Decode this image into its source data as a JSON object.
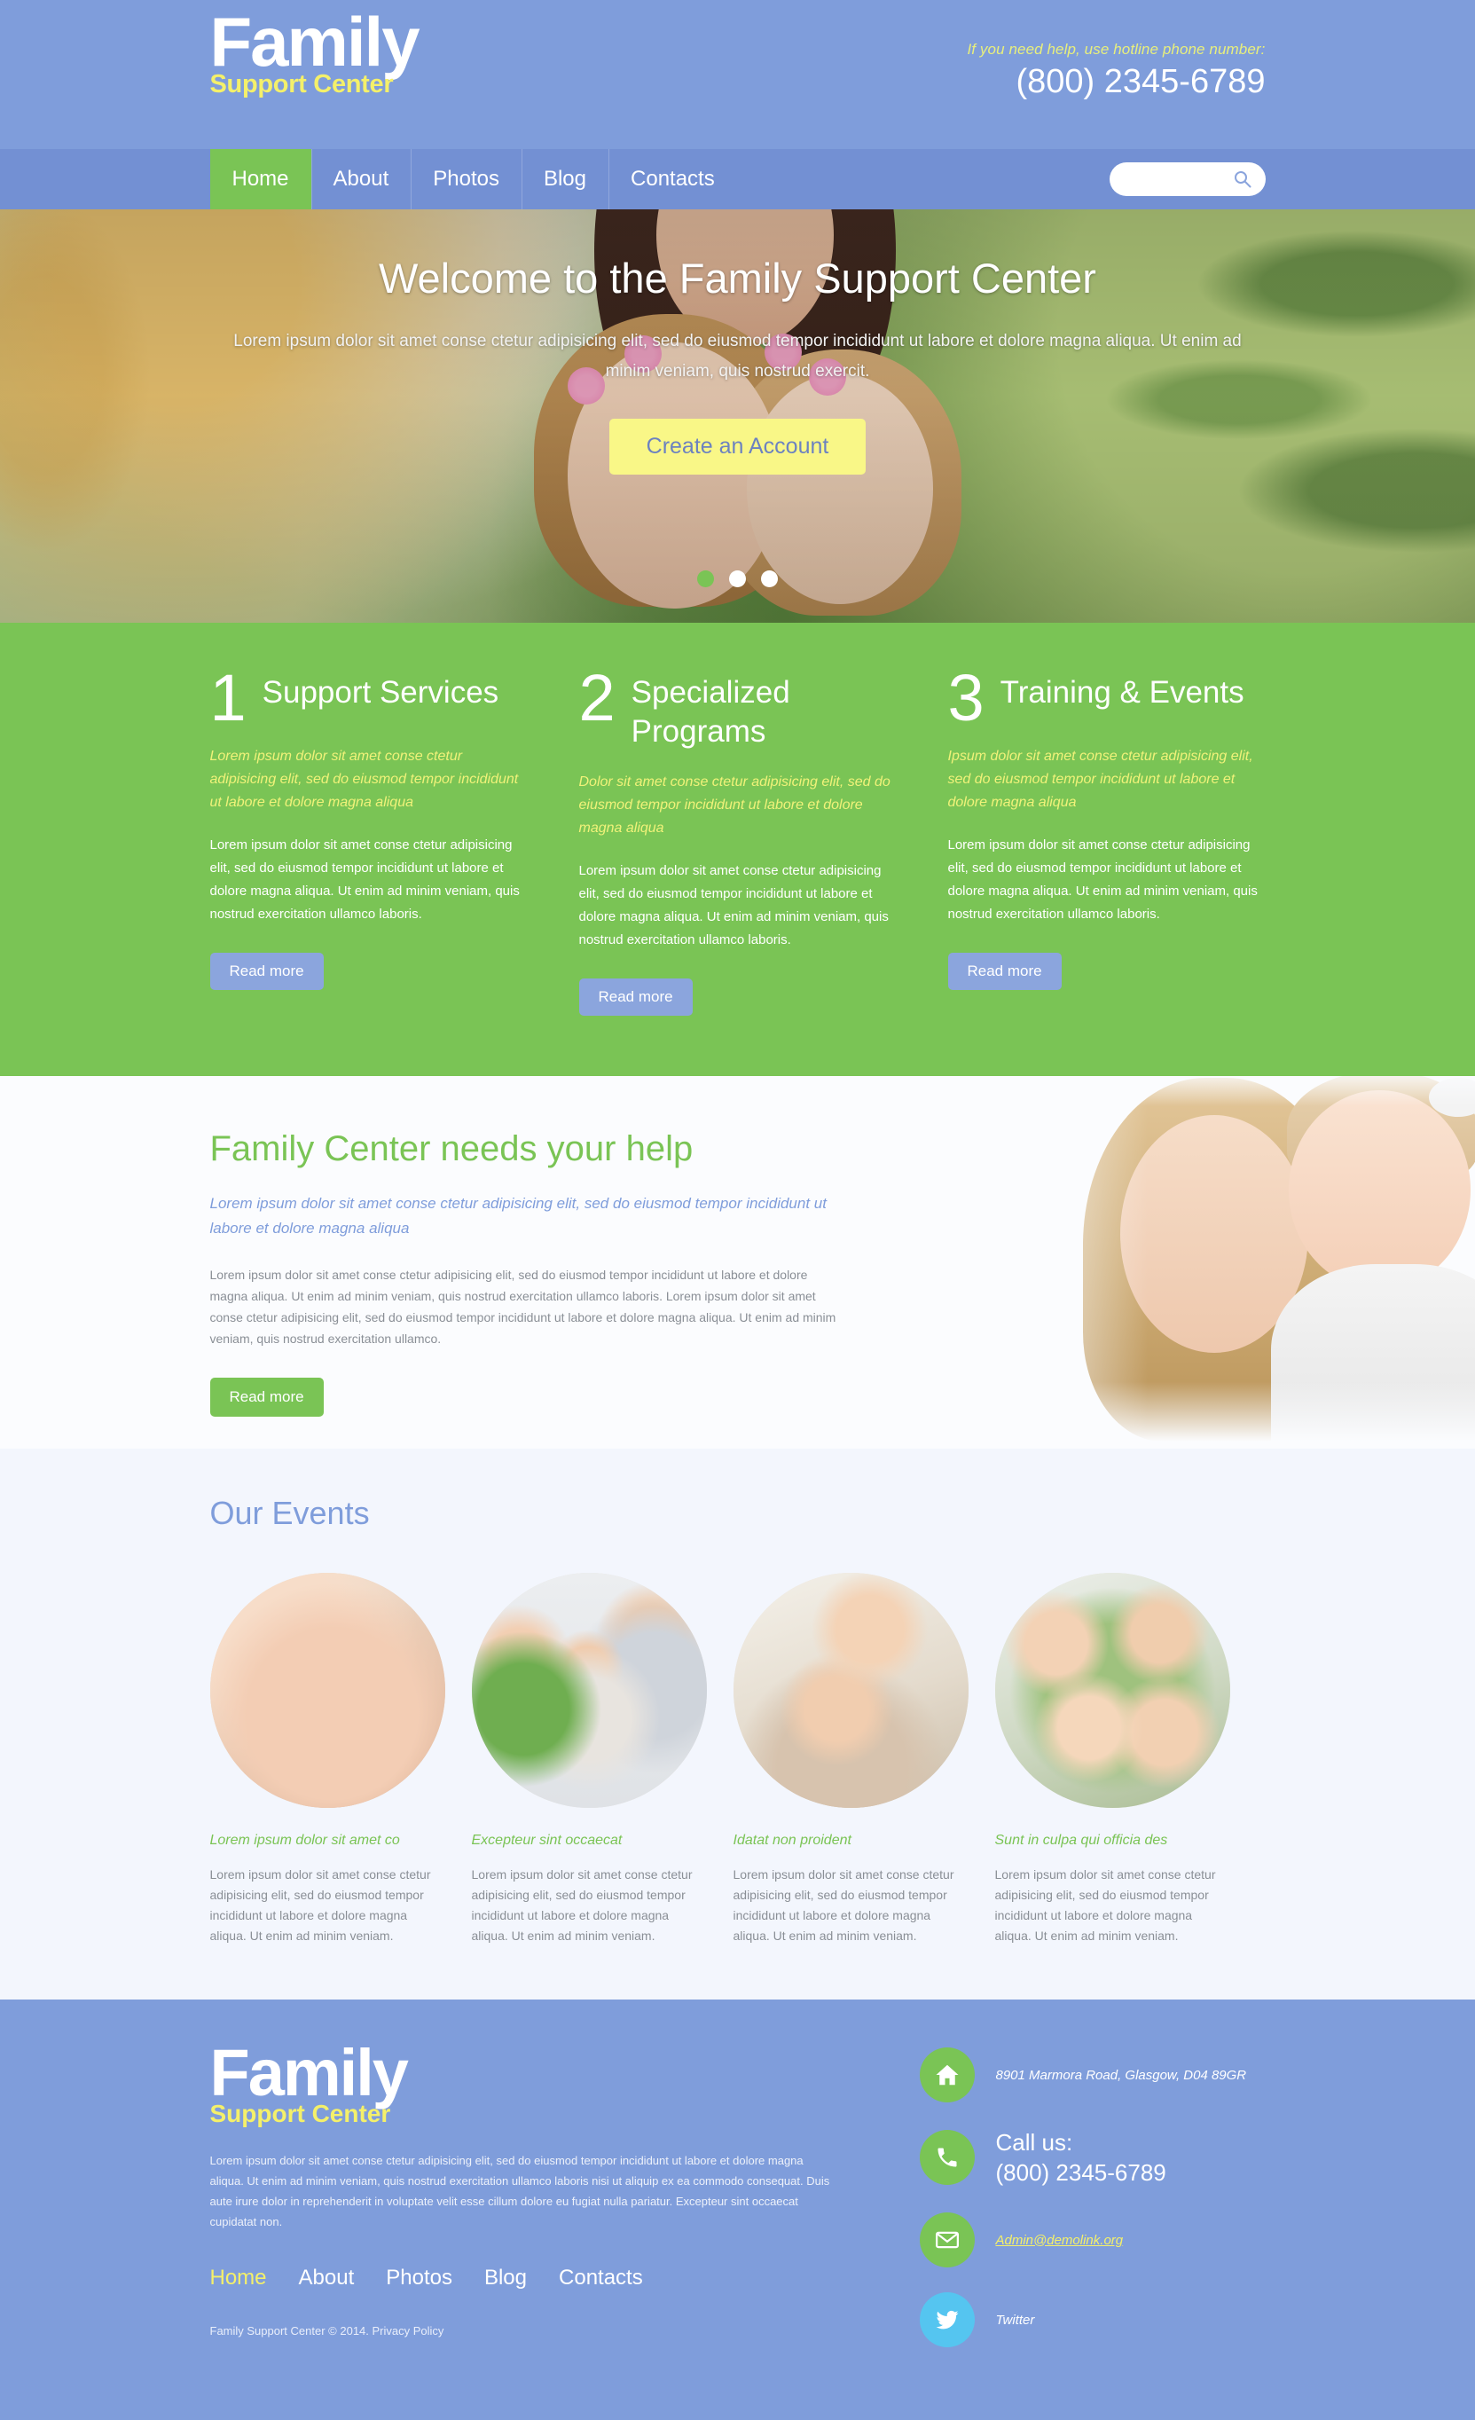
{
  "header": {
    "logo_main": "Family",
    "logo_sub": "Support Center",
    "hotline_note": "If you need help, use hotline phone number:",
    "hotline_number": "(800) 2345-6789"
  },
  "nav": {
    "items": [
      {
        "label": "Home",
        "active": true
      },
      {
        "label": "About",
        "active": false
      },
      {
        "label": "Photos",
        "active": false
      },
      {
        "label": "Blog",
        "active": false
      },
      {
        "label": "Contacts",
        "active": false
      }
    ],
    "search_placeholder": ""
  },
  "hero": {
    "title": "Welcome to the Family Support Center",
    "subtitle": "Lorem ipsum dolor sit amet conse ctetur adipisicing elit, sed do eiusmod tempor incididunt ut labore et dolore magna aliqua. Ut enim ad minim veniam, quis nostrud exercit.",
    "cta_label": "Create an Account",
    "slide_count": 3,
    "active_slide": 1
  },
  "features": {
    "items": [
      {
        "number": "1",
        "title": "Support Services",
        "lead": "Lorem ipsum dolor sit amet conse ctetur adipisicing elit, sed do eiusmod tempor incididunt ut labore et dolore magna aliqua",
        "body": "Lorem ipsum dolor sit amet conse ctetur adipisicing elit, sed do eiusmod tempor incididunt ut labore et dolore magna aliqua. Ut enim ad minim veniam, quis nostrud exercitation ullamco laboris.",
        "button": "Read more"
      },
      {
        "number": "2",
        "title": "Specialized Programs",
        "lead": "Dolor sit amet conse ctetur adipisicing elit, sed do eiusmod tempor incididunt ut labore et dolore magna aliqua",
        "body": "Lorem ipsum dolor sit amet conse ctetur adipisicing elit, sed do eiusmod tempor incididunt ut labore et dolore magna aliqua. Ut enim ad minim veniam, quis nostrud exercitation ullamco laboris.",
        "button": "Read more"
      },
      {
        "number": "3",
        "title": "Training & Events",
        "lead": "Ipsum dolor sit amet conse ctetur adipisicing elit, sed do eiusmod tempor incididunt ut labore et dolore magna aliqua",
        "body": "Lorem ipsum dolor sit amet conse ctetur adipisicing elit, sed do eiusmod tempor incididunt ut labore et dolore magna aliqua. Ut enim ad minim veniam, quis nostrud exercitation ullamco laboris.",
        "button": "Read more"
      }
    ]
  },
  "needs_help": {
    "title": "Family Center needs your help",
    "lead": "Lorem ipsum dolor sit amet conse ctetur adipisicing elit, sed do eiusmod tempor incididunt ut labore et dolore magna aliqua",
    "body": "Lorem ipsum dolor sit amet conse ctetur adipisicing elit, sed do eiusmod tempor incididunt ut labore et dolore magna aliqua. Ut enim ad minim veniam, quis nostrud exercitation ullamco laboris. Lorem ipsum dolor sit amet conse ctetur adipisicing elit, sed do eiusmod tempor incididunt ut labore et dolore magna aliqua. Ut enim ad minim veniam, quis nostrud exercitation ullamco.",
    "button": "Read more"
  },
  "events": {
    "title": "Our Events",
    "items": [
      {
        "caption": "Lorem ipsum dolor sit amet co",
        "body": "Lorem ipsum dolor sit amet conse ctetur adipisicing elit, sed do eiusmod tempor incididunt ut labore et dolore magna aliqua. Ut enim ad minim veniam."
      },
      {
        "caption": "Excepteur sint occaecat",
        "body": "Lorem ipsum dolor sit amet conse ctetur adipisicing elit, sed do eiusmod tempor incididunt ut labore et dolore magna aliqua. Ut enim ad minim veniam."
      },
      {
        "caption": "Idatat non proident",
        "body": "Lorem ipsum dolor sit amet conse ctetur adipisicing elit, sed do eiusmod tempor incididunt ut labore et dolore magna aliqua. Ut enim ad minim veniam."
      },
      {
        "caption": "Sunt in culpa qui officia des",
        "body": "Lorem ipsum dolor sit amet conse ctetur adipisicing elit, sed do eiusmod tempor incididunt ut labore et dolore magna aliqua. Ut enim ad minim veniam."
      }
    ]
  },
  "footer": {
    "logo_main": "Family",
    "logo_sub": "Support Center",
    "description": "Lorem ipsum dolor sit amet conse ctetur adipisicing elit, sed do eiusmod tempor incididunt ut labore et dolore magna aliqua. Ut enim ad minim veniam, quis nostrud exercitation ullamco laboris nisi ut aliquip ex ea commodo consequat. Duis aute irure dolor in reprehenderit in voluptate velit esse cillum dolore eu fugiat nulla pariatur. Excepteur sint occaecat cupidatat non.",
    "nav": [
      {
        "label": "Home",
        "active": true
      },
      {
        "label": "About",
        "active": false
      },
      {
        "label": "Photos",
        "active": false
      },
      {
        "label": "Blog",
        "active": false
      },
      {
        "label": "Contacts",
        "active": false
      }
    ],
    "copyright": "Family Support Center © 2014. Privacy Policy",
    "contacts": {
      "address": "8901 Marmora Road, Glasgow, D04 89GR",
      "call_label": "Call us:",
      "phone": "(800) 2345-6789",
      "email": "Admin@demolink.org",
      "twitter": "Twitter"
    }
  },
  "colors": {
    "brand_blue": "#7f9ddb",
    "nav_blue": "#7390d3",
    "green": "#7ac455",
    "yellow": "#f4f06a",
    "cta_yellow": "#f9f787",
    "twitter_blue": "#55c5f0"
  }
}
